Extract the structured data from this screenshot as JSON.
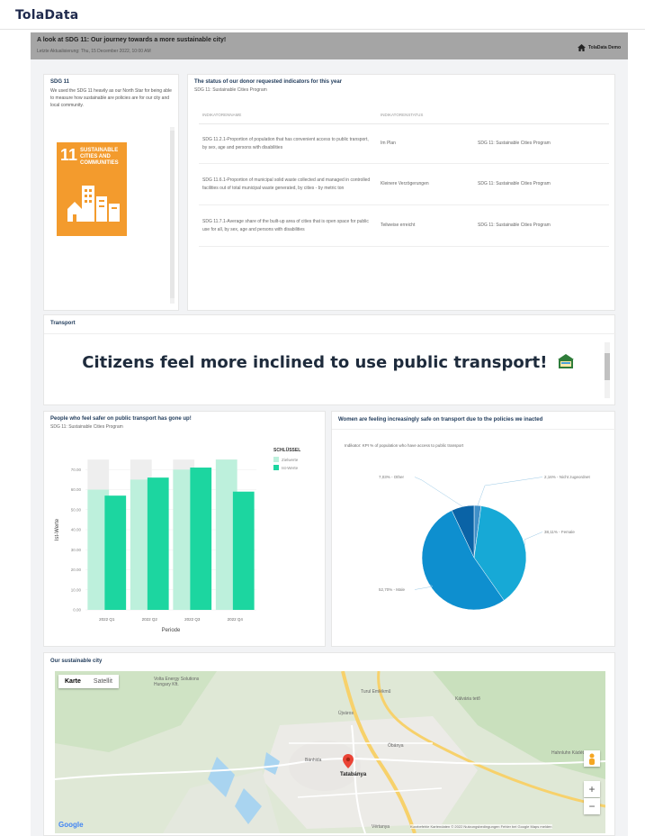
{
  "app": {
    "brand": "TolaData"
  },
  "header": {
    "title": "A look at SDG 11: Our journey towards a more sustainable city!",
    "subtitle": "Letzte Aktualisierung: Thu, 15 December 2022, 10:00 AM",
    "user": "TolaData Demo"
  },
  "sdg_card": {
    "title": "SDG 11",
    "description": "We used the SDG 11 heavily as our North Star for being able to measure how sustainable are policies are for our city and local community.",
    "tile_number": "11",
    "tile_text": "SUSTAINABLE CITIES AND COMMUNITIES"
  },
  "indicators_card": {
    "title": "The status of our donor requested indicators for this year",
    "subtitle": "SDG 11: Sustainable Cities Program",
    "columns": [
      "INDIKATORENNAME",
      "INDIKATORENSTATUS",
      ""
    ],
    "rows": [
      {
        "name": "SDG 11.2.1-Proportion of population that has convenient access to public transport, by sex, age and persons with disabilities",
        "status": "Im Plan",
        "program": "SDG 11: Sustainable Cities Program"
      },
      {
        "name": "SDG 11.6.1-Proportion of municipal solid waste collected and managed in controlled facilities out of total municipal waste generated, by cities - by metric ton",
        "status": "Kleinere Verzögerungen",
        "program": "SDG 11: Sustainable Cities Program"
      },
      {
        "name": "SDG 11.7.1-Average share of the built-up area of cities that is open space for public use for all, by sex, age and persons with disabilities",
        "status": "Teilweise erreicht",
        "program": "SDG 11: Sustainable Cities Program"
      }
    ]
  },
  "transport_card": {
    "title": "Transport",
    "banner": "Citizens feel more inclined to use public transport!"
  },
  "bar_card": {
    "title": "People who feel safer on public transport has gone up!",
    "subtitle": "SDG 11: Sustainable Cities Program",
    "legend_title": "SCHLÜSSEL",
    "legend_items": [
      "Zielwerte",
      "Ist-Werte"
    ]
  },
  "pie_card": {
    "title": "Women are feeling increasingly safe on transport due to the policies we inacted",
    "subtitle": "Indikator: KPI % of population who have access to public transport"
  },
  "map_card": {
    "title": "Our sustainable city",
    "map_toggle": [
      "Karte",
      "Satellit"
    ],
    "labels": {
      "city": "Tatabánya",
      "place1": "Volta Energy Solutions Hungary Kft.",
      "place2": "Turul Emlékmű",
      "place3": "Kálvária tető",
      "place4": "Hahnluhn Kádétó",
      "place5": "Óbánya",
      "place6": "Újváros",
      "place7": "Bánhida",
      "place8": "Vértanya",
      "google": "Google",
      "footer": "Kurzbefehle   Kartendaten © 2022   Nutzungsbedingungen   Fehler bei Google Maps melden"
    },
    "zoom_in": "+",
    "zoom_out": "−"
  },
  "colors": {
    "target": "#bdf0dc",
    "actual": "#1cd6a0",
    "sdg_orange": "#f39b2d",
    "pie_main": "#0e8fcf",
    "pie_light": "#17a9d6",
    "pie_dark": "#0a63a6"
  },
  "chart_data": [
    {
      "type": "bar",
      "categories": [
        "2022 Q1",
        "2022 Q2",
        "2022 Q3",
        "2022 Q4"
      ],
      "series": [
        {
          "name": "Zielwerte",
          "values": [
            60,
            65,
            70,
            75
          ]
        },
        {
          "name": "Ist-Werte",
          "values": [
            57,
            66,
            71,
            59
          ]
        }
      ],
      "xlabel": "Periode",
      "ylabel": "Ist-Werte",
      "ylim": [
        0,
        80
      ],
      "yticks": [
        "0.00",
        "10.00",
        "20.00",
        "30.00",
        "40.00",
        "50.00",
        "60.00",
        "70.00"
      ],
      "legend": "top-right"
    },
    {
      "type": "pie",
      "labels": [
        "Female",
        "Male",
        "Other",
        "Nicht zugeordnet"
      ],
      "values": [
        38.11,
        52.7,
        7.03,
        2.16
      ],
      "label_texts": [
        "38,11% - Female",
        "52,70% - Male",
        "7,03% - Other",
        "2,16% - Nicht zugeordnet"
      ]
    }
  ]
}
